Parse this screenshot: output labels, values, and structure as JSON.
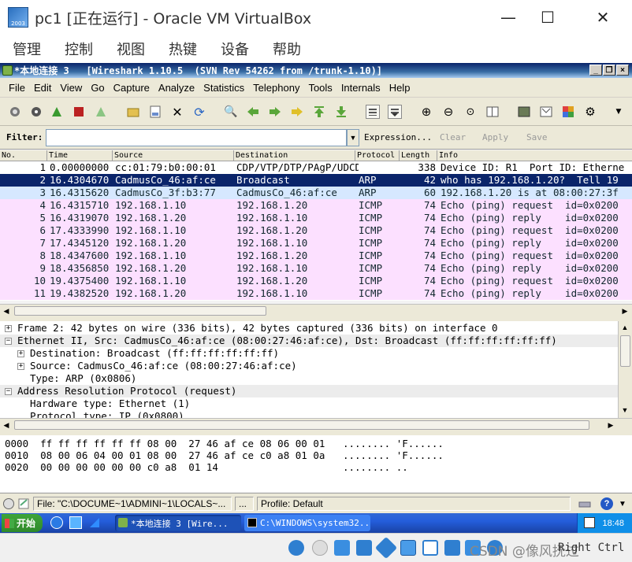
{
  "vbox": {
    "title": "pc1 [正在运行] - Oracle VM VirtualBox",
    "logo_text": "2003",
    "menu": [
      "管理",
      "控制",
      "视图",
      "热键",
      "设备",
      "帮助"
    ],
    "win_controls": {
      "minimize": "—",
      "maximize": "☐",
      "close": "✕"
    }
  },
  "wireshark": {
    "title": "*本地连接 3   [Wireshark 1.10.5  (SVN Rev 54262 from /trunk-1.10)]",
    "menu": [
      "File",
      "Edit",
      "View",
      "Go",
      "Capture",
      "Analyze",
      "Statistics",
      "Telephony",
      "Tools",
      "Internals",
      "Help"
    ],
    "filter": {
      "label": "Filter:",
      "value": "",
      "expression": "Expression...",
      "clear": "Clear",
      "apply": "Apply",
      "save": "Save"
    },
    "columns": [
      "No.",
      "Time",
      "Source",
      "Destination",
      "Protocol",
      "Length",
      "Info"
    ],
    "packets": [
      {
        "no": "1",
        "time": "0.00000000",
        "src": "cc:01:79:b0:00:01",
        "dst": "CDP/VTP/DTP/PAgP/UDCDP",
        "proto": "",
        "len": "338",
        "info": "Device ID: R1  Port ID: Etherne",
        "style": "plain"
      },
      {
        "no": "2",
        "time": "16.4304670",
        "src": "CadmusCo_46:af:ce",
        "dst": "Broadcast",
        "proto": "ARP",
        "len": "42",
        "info": "who has 192.168.1.20?  Tell 19",
        "style": "selected"
      },
      {
        "no": "3",
        "time": "16.4315620",
        "src": "CadmusCo_3f:b3:77",
        "dst": "CadmusCo_46:af:ce",
        "proto": "ARP",
        "len": "60",
        "info": "192.168.1.20 is at 08:00:27:3f",
        "style": "arp"
      },
      {
        "no": "4",
        "time": "16.4315710",
        "src": "192.168.1.10",
        "dst": "192.168.1.20",
        "proto": "ICMP",
        "len": "74",
        "info": "Echo (ping) request  id=0x0200",
        "style": "icmp"
      },
      {
        "no": "5",
        "time": "16.4319070",
        "src": "192.168.1.20",
        "dst": "192.168.1.10",
        "proto": "ICMP",
        "len": "74",
        "info": "Echo (ping) reply    id=0x0200",
        "style": "icmp"
      },
      {
        "no": "6",
        "time": "17.4333990",
        "src": "192.168.1.10",
        "dst": "192.168.1.20",
        "proto": "ICMP",
        "len": "74",
        "info": "Echo (ping) request  id=0x0200",
        "style": "icmp"
      },
      {
        "no": "7",
        "time": "17.4345120",
        "src": "192.168.1.20",
        "dst": "192.168.1.10",
        "proto": "ICMP",
        "len": "74",
        "info": "Echo (ping) reply    id=0x0200",
        "style": "icmp"
      },
      {
        "no": "8",
        "time": "18.4347600",
        "src": "192.168.1.10",
        "dst": "192.168.1.20",
        "proto": "ICMP",
        "len": "74",
        "info": "Echo (ping) request  id=0x0200",
        "style": "icmp"
      },
      {
        "no": "9",
        "time": "18.4356850",
        "src": "192.168.1.20",
        "dst": "192.168.1.10",
        "proto": "ICMP",
        "len": "74",
        "info": "Echo (ping) reply    id=0x0200",
        "style": "icmp"
      },
      {
        "no": "10",
        "time": "19.4375400",
        "src": "192.168.1.10",
        "dst": "192.168.1.20",
        "proto": "ICMP",
        "len": "74",
        "info": "Echo (ping) request  id=0x0200",
        "style": "icmp"
      },
      {
        "no": "11",
        "time": "19.4382520",
        "src": "192.168.1.20",
        "dst": "192.168.1.10",
        "proto": "ICMP",
        "len": "74",
        "info": "Echo (ping) reply    id=0x0200",
        "style": "icmp"
      }
    ],
    "details": [
      {
        "indent": 0,
        "toggle": "+",
        "text": "Frame 2: 42 bytes on wire (336 bits), 42 bytes captured (336 bits) on interface 0",
        "hl": false
      },
      {
        "indent": 0,
        "toggle": "−",
        "text": "Ethernet II, Src: CadmusCo_46:af:ce (08:00:27:46:af:ce), Dst: Broadcast (ff:ff:ff:ff:ff:ff)",
        "hl": true
      },
      {
        "indent": 1,
        "toggle": "+",
        "text": "Destination: Broadcast (ff:ff:ff:ff:ff:ff)",
        "hl": false
      },
      {
        "indent": 1,
        "toggle": "+",
        "text": "Source: CadmusCo_46:af:ce (08:00:27:46:af:ce)",
        "hl": false
      },
      {
        "indent": 1,
        "toggle": "",
        "text": "Type: ARP (0x0806)",
        "hl": false
      },
      {
        "indent": 0,
        "toggle": "−",
        "text": "Address Resolution Protocol (request)",
        "hl": true
      },
      {
        "indent": 1,
        "toggle": "",
        "text": "Hardware type: Ethernet (1)",
        "hl": false
      },
      {
        "indent": 1,
        "toggle": "",
        "text": "Protocol type: IP (0x0800)",
        "hl": false
      }
    ],
    "bytes": [
      "0000  ff ff ff ff ff ff 08 00  27 46 af ce 08 06 00 01   ........ 'F......",
      "0010  08 00 06 04 00 01 08 00  27 46 af ce c0 a8 01 0a   ........ 'F......",
      "0020  00 00 00 00 00 00 c0 a8  01 14                     ........ .."
    ],
    "status": {
      "file": "File: \"C:\\DOCUME~1\\ADMINI~1\\LOCALS~...",
      "middle": "...",
      "profile": "Profile: Default"
    }
  },
  "taskbar": {
    "start": "开始",
    "tasks": [
      "*本地连接 3   [Wire...",
      "C:\\WINDOWS\\system32..."
    ],
    "clock": "18:48"
  },
  "vbox_status": {
    "hostkey": "Right Ctrl",
    "watermark": "CSDN @像风抚过"
  }
}
